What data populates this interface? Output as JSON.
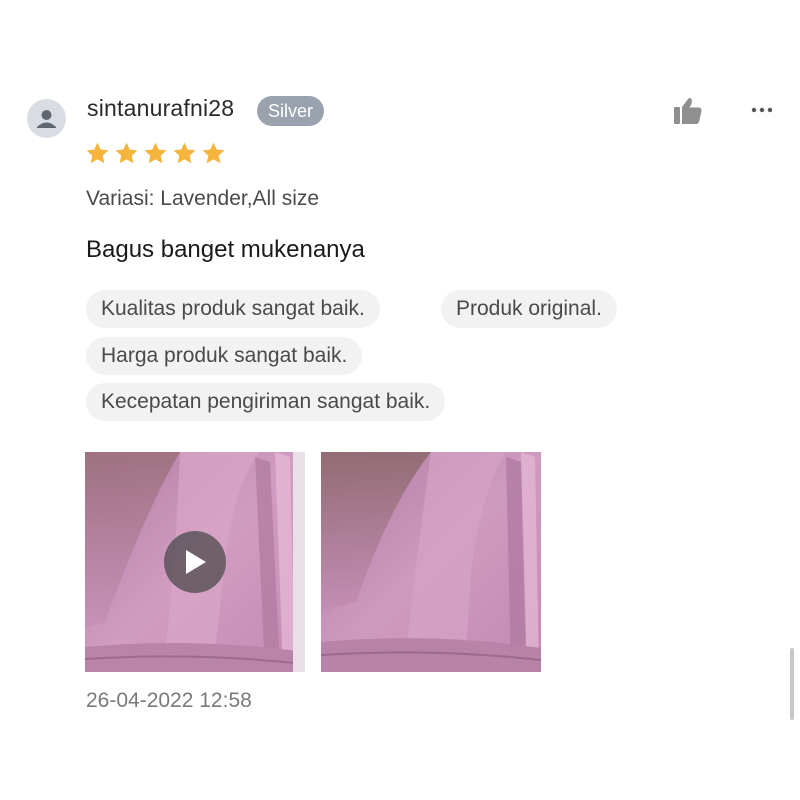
{
  "review": {
    "username": "sintanurafni28",
    "badge": "Silver",
    "rating": 5,
    "max_rating": 5,
    "variation": "Variasi: Lavender,All size",
    "comment": "Bagus banget mukenanya",
    "tags": [
      "Kualitas produk sangat baik.",
      "Produk original.",
      "Harga produk sangat baik.",
      "Kecepatan pengiriman sangat baik."
    ],
    "media": [
      {
        "type": "video",
        "icon": "play-icon"
      },
      {
        "type": "photo"
      }
    ],
    "timestamp": "26-04-2022 12:58"
  },
  "icons": {
    "avatar": "user-icon",
    "like": "thumbs-up-icon",
    "more": "more-dots-icon",
    "star": "star-icon"
  },
  "colors": {
    "star": "#f5b43c",
    "badge": "#9aa2ae",
    "chip_bg": "#f2f2f2",
    "fabric": "#c98fb8"
  }
}
